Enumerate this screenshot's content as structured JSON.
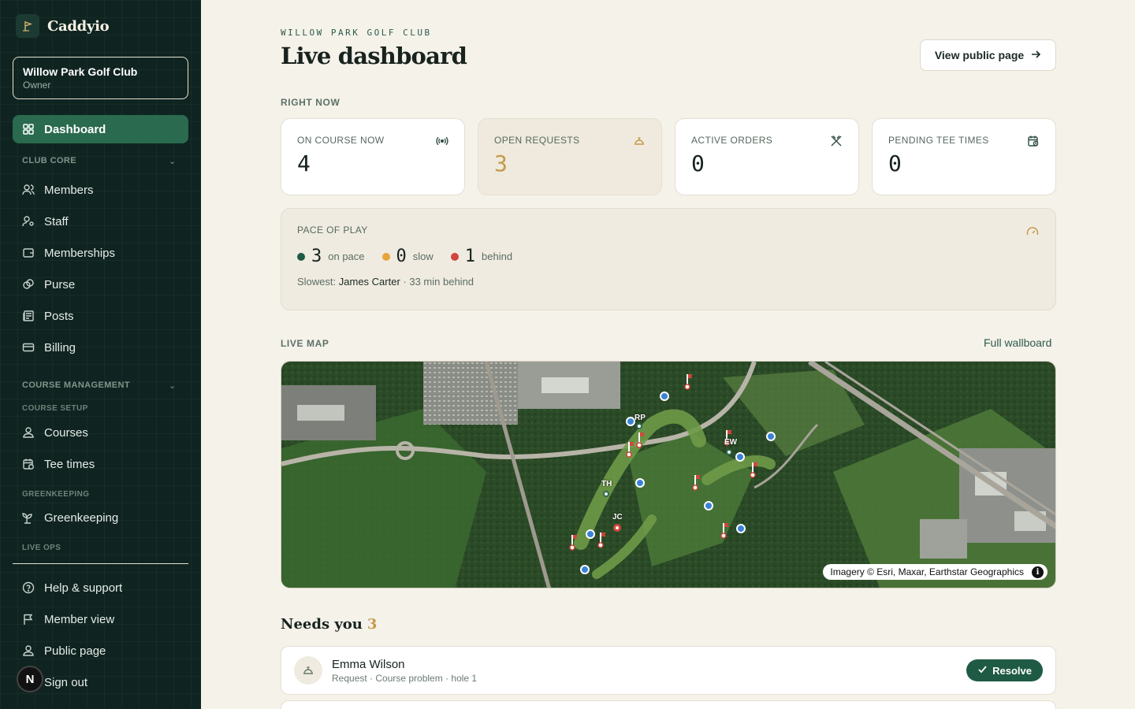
{
  "brand": {
    "name": "Caddyio",
    "logo_icon": "flag-icon"
  },
  "club": {
    "name": "Willow Park Golf Club",
    "role": "Owner"
  },
  "sidebar": {
    "dashboard": "Dashboard",
    "section_club_core": "CLUB CORE",
    "club_core_items": [
      "Members",
      "Staff",
      "Memberships",
      "Purse",
      "Posts",
      "Billing"
    ],
    "section_course_management": "COURSE MANAGEMENT",
    "subsection_course_setup": "COURSE SETUP",
    "course_setup_items": [
      "Courses",
      "Tee times"
    ],
    "subsection_greenkeeping": "GREENKEEPING",
    "greenkeeping_items": [
      "Greenkeeping"
    ],
    "subsection_live_ops": "LIVE OPS",
    "footer_items": [
      "Help & support",
      "Member view",
      "Public page",
      "Sign out"
    ],
    "avatar_letter": "N"
  },
  "header": {
    "eyebrow": "WILLOW PARK GOLF CLUB",
    "title": "Live dashboard",
    "public_button": "View public page"
  },
  "right_now": {
    "label": "RIGHT NOW",
    "stats": [
      {
        "label": "ON COURSE NOW",
        "value": "4",
        "icon": "broadcast-icon"
      },
      {
        "label": "OPEN REQUESTS",
        "value": "3",
        "icon": "bell-icon"
      },
      {
        "label": "ACTIVE ORDERS",
        "value": "0",
        "icon": "utensils-icon"
      },
      {
        "label": "PENDING TEE TIMES",
        "value": "0",
        "icon": "calendar-clock-icon"
      }
    ]
  },
  "pace": {
    "label": "PACE OF PLAY",
    "on_pace": {
      "value": "3",
      "word": "on pace",
      "color": "#1f5a45"
    },
    "slow": {
      "value": "0",
      "word": "slow",
      "color": "#e8a33d"
    },
    "behind": {
      "value": "1",
      "word": "behind",
      "color": "#d2453a"
    },
    "slowest_prefix": "Slowest:",
    "slowest_name": "James Carter",
    "slowest_suffix": "· 33 min behind"
  },
  "live_map": {
    "label": "LIVE MAP",
    "wallboard_link": "Full wallboard",
    "attribution": "Imagery © Esri, Maxar, Earthstar Geographics",
    "player_labels": [
      "RP",
      "EW",
      "TH",
      "JC"
    ]
  },
  "needs_you": {
    "title": "Needs you",
    "count": "3",
    "items": [
      {
        "name": "Emma Wilson",
        "meta": "Request · Course problem · hole 1",
        "action": "Resolve"
      }
    ]
  },
  "colors": {
    "sidebar_bg": "#0f2420",
    "accent": "#2a6a4f",
    "gold": "#c59a4c",
    "page_bg": "#f5f2ea"
  }
}
